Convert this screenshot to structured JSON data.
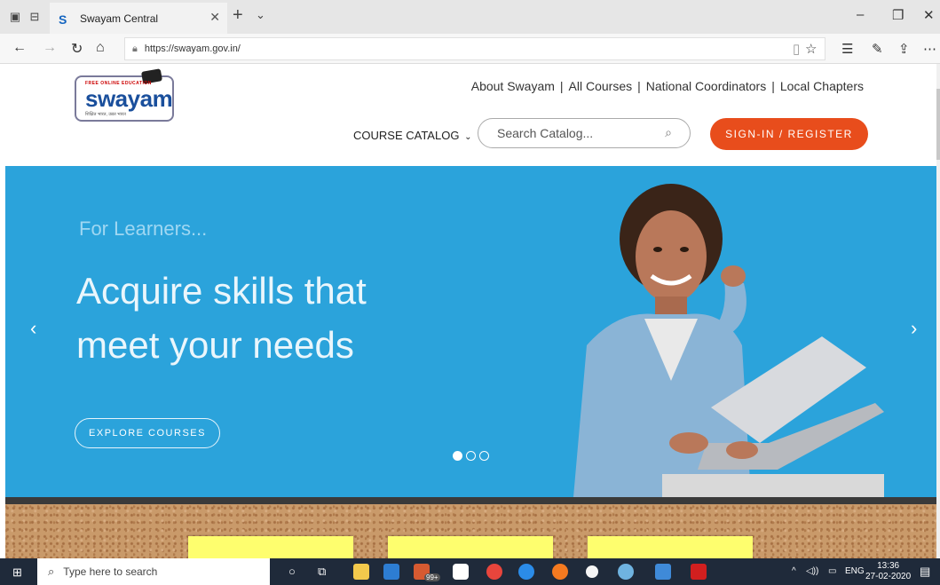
{
  "browser": {
    "tab_title": "Swayam Central",
    "tab_favicon": "S",
    "url": "https://swayam.gov.in/"
  },
  "header": {
    "logo": {
      "tagline_top": "FREE ONLINE EDUCATION",
      "wordmark": "swayam",
      "tagline_bottom": "शिक्षित भारत, उन्नत भारत"
    },
    "links": [
      "About Swayam",
      "All Courses",
      "National Coordinators",
      "Local Chapters"
    ],
    "separator": "|",
    "catalog_label": "COURSE CATALOG",
    "search_placeholder": "Search Catalog...",
    "signin_label": "SIGN-IN / REGISTER"
  },
  "hero": {
    "eyebrow": "For Learners...",
    "headline": "Acquire skills that meet your needs",
    "cta_label": "EXPLORE COURSES",
    "slides_total": 3,
    "active_slide": 1,
    "background_color": "#2ba3db"
  },
  "taskbar": {
    "search_placeholder": "Type here to search",
    "badge": "99+",
    "language": "ENG",
    "time": "13:36",
    "date": "27-02-2020"
  },
  "colors": {
    "accent": "#e84d1c",
    "brand_blue": "#1a4f9c"
  }
}
